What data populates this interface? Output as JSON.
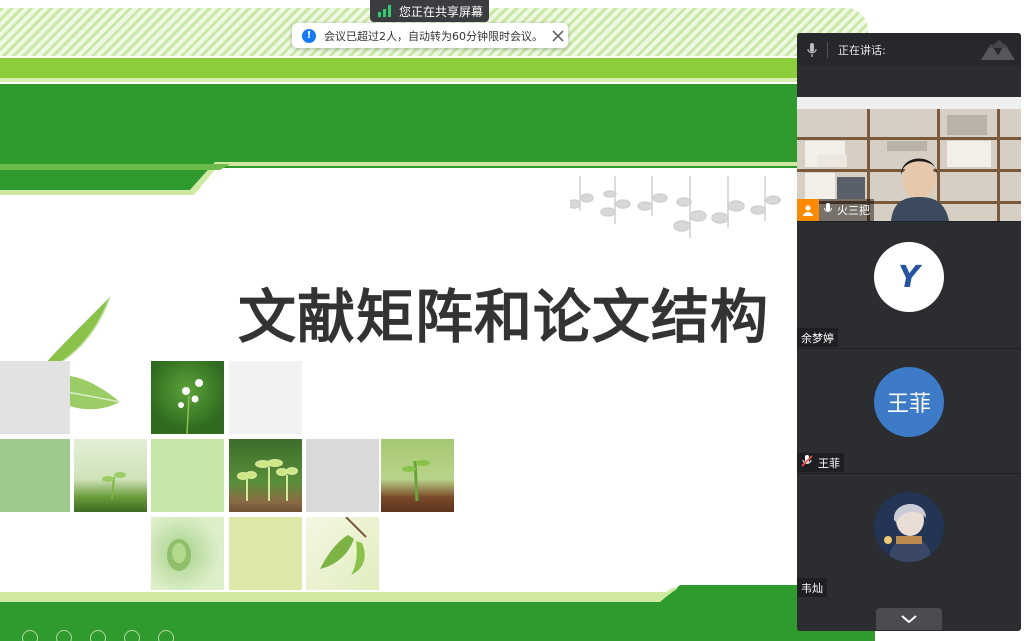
{
  "slide": {
    "title": "文献矩阵和论文结构"
  },
  "share_banner": {
    "label": "您正在共享屏幕",
    "notice": "会议已超过2人，自动转为60分钟限时会议。"
  },
  "panel": {
    "speaking_label": "正在讲话:",
    "participants": [
      {
        "name": "火三把",
        "type": "video"
      },
      {
        "name": "余梦婷",
        "avatar": "Y"
      },
      {
        "name": "王菲",
        "avatar_text": "王菲",
        "muted": true
      },
      {
        "name": "韦灿"
      }
    ]
  },
  "colors": {
    "slide_green": "#2f9a2d",
    "slide_lime": "#8ccd3c",
    "panel_bg": "#2b2d31",
    "avatar_blue": "#3d7ac7",
    "info_blue": "#1677ff"
  },
  "icons": {
    "share_status": "signal-bars-icon",
    "notice": "info-icon",
    "close": "close-icon",
    "mic": "microphone-icon",
    "muted": "muted-microphone-icon",
    "expand": "chevron-down-icon"
  }
}
